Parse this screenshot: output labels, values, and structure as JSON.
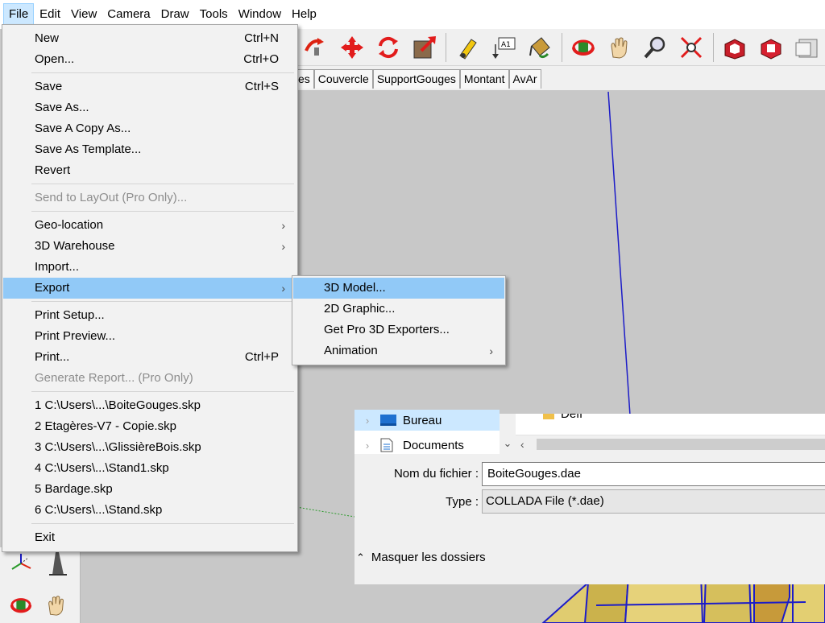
{
  "menubar": {
    "items": [
      "File",
      "Edit",
      "View",
      "Camera",
      "Draw",
      "Tools",
      "Window",
      "Help"
    ]
  },
  "toolbar": {
    "icons": [
      "follow-me-icon",
      "move-icon",
      "rotate-icon",
      "scale-icon",
      "tape-measure-icon",
      "text-icon",
      "paint-bucket-icon",
      "orbit-icon",
      "pan-icon",
      "zoom-icon",
      "zoom-extents-icon",
      "warehouse-icon",
      "extension-warehouse-icon",
      "layout-icon"
    ]
  },
  "scene_tabs": [
    "es",
    "Couvercle",
    "SupportGouges",
    "Montant",
    "AvAr"
  ],
  "file_menu": {
    "items": [
      {
        "label": "New",
        "shortcut": "Ctrl+N"
      },
      {
        "label": "Open...",
        "shortcut": "Ctrl+O"
      },
      {
        "label": "Save",
        "shortcut": "Ctrl+S"
      },
      {
        "label": "Save As...",
        "shortcut": ""
      },
      {
        "label": "Save A Copy As...",
        "shortcut": ""
      },
      {
        "label": "Save As Template...",
        "shortcut": ""
      },
      {
        "label": "Revert",
        "shortcut": ""
      },
      {
        "label": "Send to LayOut (Pro Only)...",
        "shortcut": ""
      },
      {
        "label": "Geo-location",
        "shortcut": ""
      },
      {
        "label": "3D Warehouse",
        "shortcut": ""
      },
      {
        "label": "Import...",
        "shortcut": ""
      },
      {
        "label": "Export",
        "shortcut": ""
      },
      {
        "label": "Print Setup...",
        "shortcut": ""
      },
      {
        "label": "Print Preview...",
        "shortcut": ""
      },
      {
        "label": "Print...",
        "shortcut": "Ctrl+P"
      },
      {
        "label": "Generate Report... (Pro Only)",
        "shortcut": ""
      },
      {
        "label": "1 C:\\Users\\...\\BoiteGouges.skp",
        "shortcut": ""
      },
      {
        "label": "2 Etagères-V7 - Copie.skp",
        "shortcut": ""
      },
      {
        "label": "3 C:\\Users\\...\\GlissièreBois.skp",
        "shortcut": ""
      },
      {
        "label": "4 C:\\Users\\...\\Stand1.skp",
        "shortcut": ""
      },
      {
        "label": "5 Bardage.skp",
        "shortcut": ""
      },
      {
        "label": "6 C:\\Users\\...\\Stand.skp",
        "shortcut": ""
      },
      {
        "label": "Exit",
        "shortcut": ""
      }
    ],
    "submenu_arrow": "›"
  },
  "export_submenu": {
    "items": [
      "3D Model...",
      "2D Graphic...",
      "Get Pro 3D Exporters...",
      "Animation"
    ]
  },
  "dialog": {
    "nav": [
      "Bureau",
      "Documents"
    ],
    "file_partial": "Défi",
    "filename_label": "Nom du fichier :",
    "filename_value": "BoiteGouges.dae",
    "type_label": "Type :",
    "type_value": "COLLADA File (*.dae)",
    "hide_folders": "Masquer les dossiers",
    "chev_right": "›",
    "chev_down": "⌄",
    "chev_up": "⌃",
    "scroll_left": "‹"
  },
  "colors": {
    "menu_highlight": "#91c9f7",
    "menubar_active": "#cce8ff",
    "axis_blue": "#1c1cc8",
    "axis_green": "#2a9a2a"
  }
}
